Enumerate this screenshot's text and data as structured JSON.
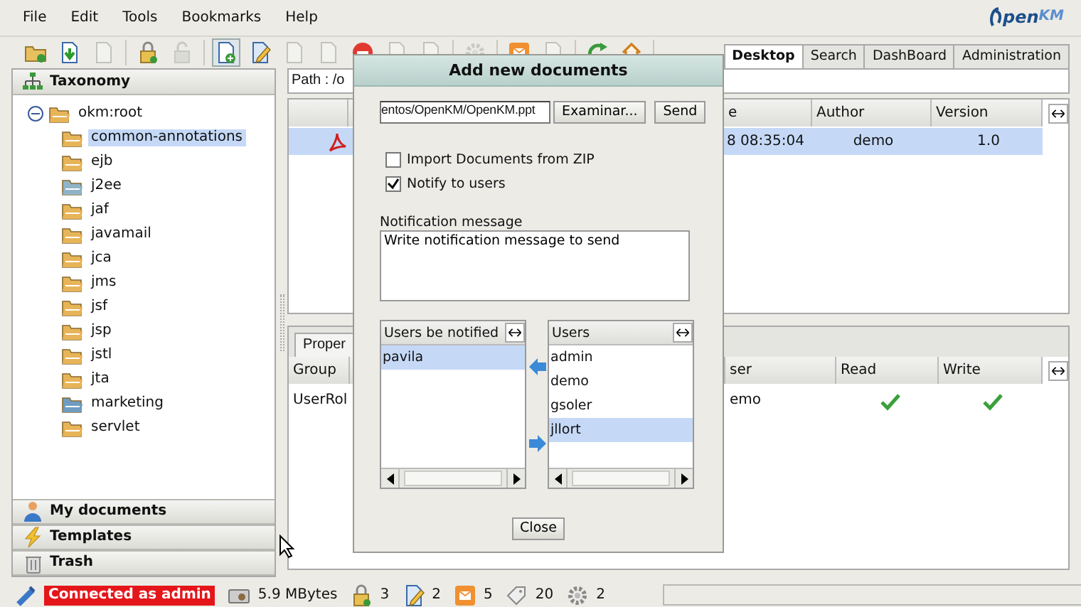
{
  "menu": [
    "File",
    "Edit",
    "Tools",
    "Bookmarks",
    "Help"
  ],
  "logo": {
    "main": "pen",
    "accent": "KM"
  },
  "toolbar": [
    [
      {
        "kind": "folder",
        "disabled": false,
        "pressed": false
      },
      {
        "kind": "download",
        "disabled": false,
        "pressed": false
      },
      {
        "kind": "document",
        "disabled": true,
        "pressed": false
      }
    ],
    [
      {
        "kind": "lock",
        "disabled": false,
        "pressed": false
      },
      {
        "kind": "unlock",
        "disabled": true,
        "pressed": false
      }
    ],
    [
      {
        "kind": "add",
        "disabled": false,
        "pressed": true
      },
      {
        "kind": "edit",
        "disabled": false,
        "pressed": false
      },
      {
        "kind": "document",
        "disabled": true,
        "pressed": false
      },
      {
        "kind": "document",
        "disabled": true,
        "pressed": false
      },
      {
        "kind": "delete",
        "disabled": false,
        "pressed": false
      },
      {
        "kind": "document",
        "disabled": true,
        "pressed": false
      },
      {
        "kind": "document",
        "disabled": true,
        "pressed": false
      }
    ],
    [
      {
        "kind": "gear",
        "disabled": true,
        "pressed": false
      }
    ],
    [
      {
        "kind": "mail",
        "disabled": false,
        "pressed": false
      },
      {
        "kind": "document",
        "disabled": true,
        "pressed": false
      }
    ],
    [
      {
        "kind": "refresh",
        "disabled": false,
        "pressed": false
      },
      {
        "kind": "home",
        "disabled": false,
        "pressed": false
      }
    ]
  ],
  "tabs": [
    {
      "label": "Desktop",
      "selected": true
    },
    {
      "label": "Search",
      "selected": false
    },
    {
      "label": "DashBoard",
      "selected": false
    },
    {
      "label": "Administration",
      "selected": false
    }
  ],
  "taxonomy": {
    "title": "Taxonomy",
    "tree": [
      {
        "label": "okm:root",
        "expanded": true,
        "selected": false,
        "color": "#e8b458",
        "children": [
          {
            "label": "common-annotations",
            "selected": true,
            "color": "#e8b458"
          },
          {
            "label": "ejb",
            "selected": false,
            "color": "#e8b458"
          },
          {
            "label": "j2ee",
            "selected": false,
            "color": "#8fb4c8"
          },
          {
            "label": "jaf",
            "selected": false,
            "color": "#e8b458"
          },
          {
            "label": "javamail",
            "selected": false,
            "color": "#e8b458"
          },
          {
            "label": "jca",
            "selected": false,
            "color": "#e8b458"
          },
          {
            "label": "jms",
            "selected": false,
            "color": "#e8b458"
          },
          {
            "label": "jsf",
            "selected": false,
            "color": "#e8b458"
          },
          {
            "label": "jsp",
            "selected": false,
            "color": "#e8b458"
          },
          {
            "label": "jstl",
            "selected": false,
            "color": "#e8b458"
          },
          {
            "label": "jta",
            "selected": false,
            "color": "#e8b458"
          },
          {
            "label": "marketing",
            "selected": false,
            "color": "#6f9cc0"
          },
          {
            "label": "servlet",
            "selected": false,
            "color": "#e8b458"
          }
        ]
      }
    ]
  },
  "panels": [
    {
      "kind": "user",
      "label": "My documents"
    },
    {
      "kind": "bolt",
      "label": "Templates"
    },
    {
      "kind": "trash",
      "label": "Trash"
    }
  ],
  "path": "Path : /o",
  "documents": {
    "columns": [
      "e",
      "Author",
      "Version"
    ],
    "rows": [
      {
        "selected": true,
        "cells": [
          "8 08:35:04",
          "demo",
          "1.0"
        ]
      }
    ]
  },
  "properties": {
    "tabs": [
      {
        "label": "Proper",
        "selected": true
      }
    ],
    "columns": [
      "Group",
      "ser",
      "Read",
      "Write"
    ],
    "rows": [
      {
        "group": "UserRol",
        "user": "emo",
        "read": true,
        "write": true
      }
    ]
  },
  "dialog": {
    "title": "Add new documents",
    "file_value": "entos/OpenKM/OpenKM.ppt",
    "browse_button": "Examinar...",
    "send_button": "Send",
    "checkboxes": [
      {
        "label": "Import Documents from ZIP",
        "checked": false
      },
      {
        "label": "Notify to users",
        "checked": true
      }
    ],
    "message_label": "Notification message",
    "message_value": "Write notification message to send",
    "notified": {
      "title": "Users be notified",
      "items": [
        {
          "name": "pavila",
          "selected": true
        }
      ]
    },
    "users": {
      "title": "Users",
      "items": [
        {
          "name": "admin",
          "selected": false
        },
        {
          "name": "demo",
          "selected": false
        },
        {
          "name": "gsoler",
          "selected": false
        },
        {
          "name": "jllort",
          "selected": true
        }
      ]
    },
    "close_button": "Close"
  },
  "status_bar": {
    "connection": "Connected as admin",
    "items": [
      {
        "kind": "disk",
        "text": "5.9 MBytes"
      },
      {
        "kind": "lock",
        "text": "3"
      },
      {
        "kind": "edit",
        "text": "2"
      },
      {
        "kind": "mail",
        "text": "5"
      },
      {
        "kind": "tag",
        "text": "20"
      },
      {
        "kind": "gear",
        "text": "2"
      }
    ]
  }
}
